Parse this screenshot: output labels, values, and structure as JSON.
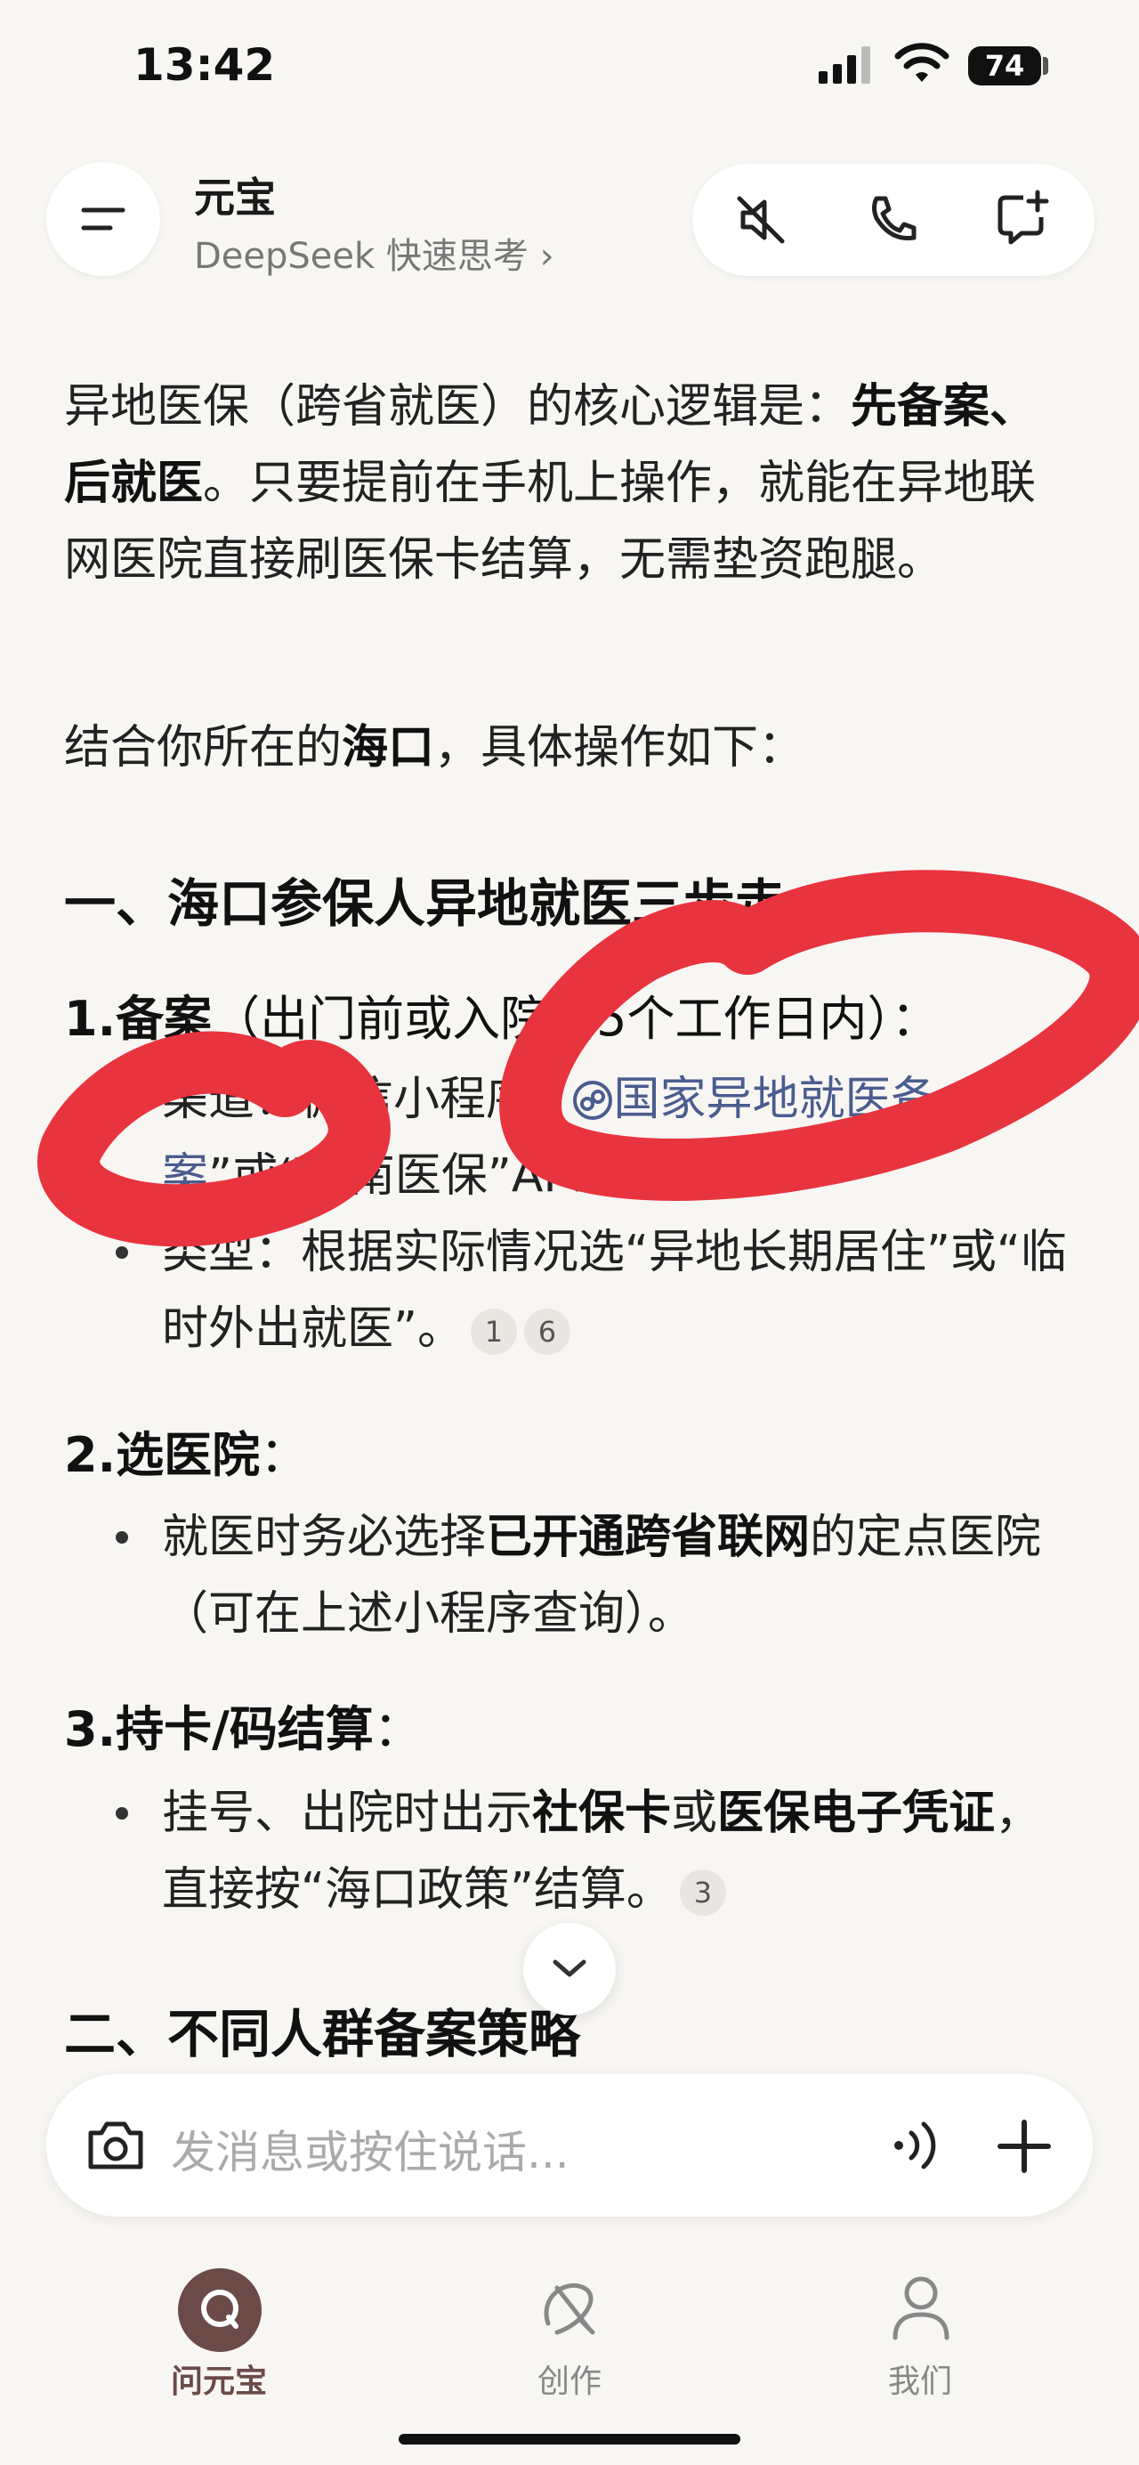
{
  "status_bar": {
    "time": "13:42",
    "battery": "74"
  },
  "header": {
    "title": "元宝",
    "subtitle": "DeepSeek 快速思考 ›"
  },
  "content": {
    "intro_1": "异地医保（跨省就医）的核心逻辑是：",
    "intro_bold": "先备案、后就医",
    "intro_2": "。只要提前在手机上操作，就能在异地联网医院直接刷医保卡结算，无需垫资跑腿。",
    "context_1": "结合你所在的",
    "context_bold": "海口",
    "context_2": "，具体操作如下：",
    "section1_title": "一、海口参保人异地就医三步走",
    "step1_title": "1.备案",
    "step1_note": "（出门前或入院后5个工作日内）：",
    "step1_b1_prefix": "渠道：微信小程序",
    "step1_b1_link": "国家异地就医备案",
    "step1_b1_suffix": "”或“海南医保”APP。",
    "step1_b2": "类型：根据实际情况选“异地长期居住”或“临时外出就医”。",
    "step1_cites": [
      "1",
      "6"
    ],
    "step2_title": "2.选医院",
    "step2_colon": "：",
    "step2_b1_pre": "就医时务必选择",
    "step2_b1_bold": "已开通跨省联网",
    "step2_b1_post": "的定点医院（可在上述小程序查询）。",
    "step3_title": "3.持卡/码结算",
    "step3_colon": "：",
    "step3_b1_pre": "挂号、出院时出示",
    "step3_b1_bold1": "社保卡",
    "step3_b1_mid": "或",
    "step3_b1_bold2": "医保电子凭证",
    "step3_b1_post": "，直接按“海口政策”结算。",
    "step3_cites": [
      "3"
    ],
    "section2_title": "二、不同人群备案策略"
  },
  "input": {
    "placeholder": "发消息或按住说话..."
  },
  "tabs": [
    {
      "label": "问元宝",
      "active": true
    },
    {
      "label": "创作",
      "active": false
    },
    {
      "label": "我们",
      "active": false
    }
  ],
  "colors": {
    "background": "#f8f6f3",
    "accent": "#6b4a48",
    "link": "#4a5d8f",
    "annotation": "#e8343f"
  }
}
